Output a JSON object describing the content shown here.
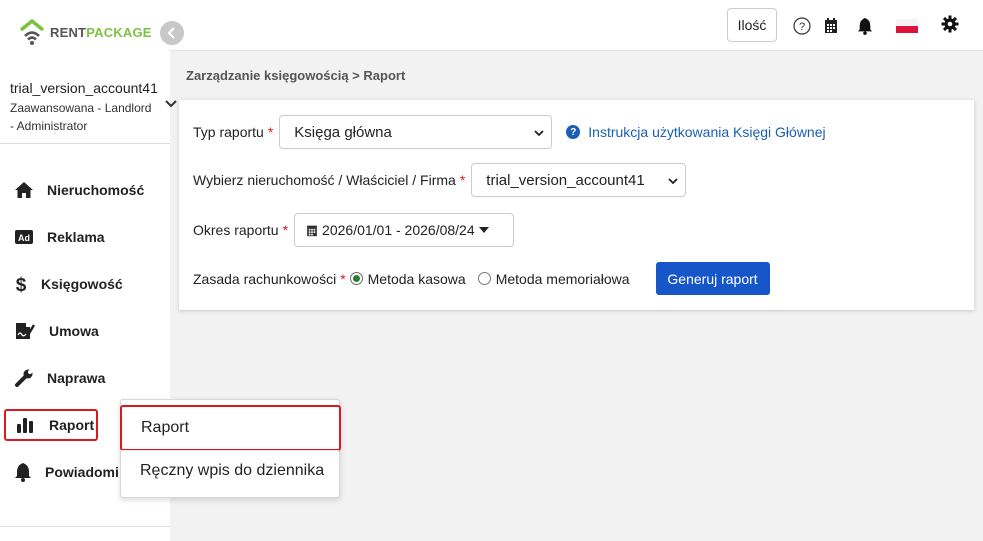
{
  "brand": {
    "rent": "RENT",
    "package": "PACKAGE",
    "accent": "#7cc242"
  },
  "account": {
    "name": "trial_version_account41",
    "role_line1": "Zaawansowana - Landlord",
    "role_line2": "- Administrator"
  },
  "sidebar": {
    "items": [
      {
        "label": "Nieruchomość",
        "icon": "house-icon"
      },
      {
        "label": "Reklama",
        "icon": "ad-icon"
      },
      {
        "label": "Księgowość",
        "icon": "dollar-icon"
      },
      {
        "label": "Umowa",
        "icon": "signature-icon"
      },
      {
        "label": "Naprawa",
        "icon": "wrench-icon"
      },
      {
        "label": "Raport",
        "icon": "bar-chart-icon",
        "active": true
      },
      {
        "label": "Powiadomi",
        "icon": "bell-icon"
      }
    ]
  },
  "topbar": {
    "quantity_label": "Ilość",
    "icons": [
      "help-circle-icon",
      "calendar-icon",
      "bell-icon",
      "flag-pl-icon",
      "gear-icon"
    ]
  },
  "breadcrumb": "Zarządzanie księgowością > Raport",
  "form": {
    "report_type_label": "Typ raportu",
    "report_type_value": "Księga główna",
    "help_link": "Instrukcja użytkowania Księgi Głównej",
    "property_label": "Wybierz nieruchomość / Właściciel / Firma",
    "property_value": "trial_version_account41",
    "period_label": "Okres raportu",
    "period_value": "2026/01/01 - 2026/08/24",
    "accounting_label": "Zasada rachunkowości",
    "option_cash": "Metoda kasowa",
    "option_accrual": "Metoda memoriałowa",
    "selected_option": "Metoda kasowa",
    "required_mark": "*",
    "generate_button": "Generuj raport"
  },
  "submenu": {
    "items": [
      "Raport",
      "Ręczny wpis do dziennika"
    ]
  },
  "colors": {
    "primary": "#1656c9",
    "danger": "#d9181f",
    "link": "#1a5fb4"
  }
}
